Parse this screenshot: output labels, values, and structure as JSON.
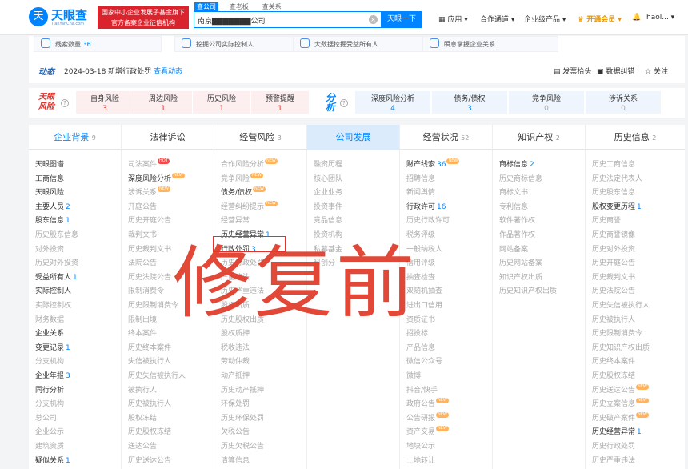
{
  "brand": {
    "logo_glyph": "天",
    "logo_text": "天眼查",
    "logo_sub": "TianYanCha.com",
    "promo_line1": "国家中小企业发展子基金旗下",
    "promo_line2": "官方备案企业征信机构"
  },
  "search": {
    "tabs": [
      "查公司",
      "查老板",
      "查关系"
    ],
    "value": "南京▇▇▇▇▇▇▇公司",
    "clear_glyph": "×",
    "button": "天眼一下"
  },
  "nav": {
    "app": "应用 ▾",
    "channel": "合作通道 ▾",
    "enterprise": "企业级产品 ▾",
    "vip": "开通会员 ▾",
    "user": "haol... ▾"
  },
  "features": [
    {
      "label": "线索数量",
      "num": "36"
    },
    {
      "label": "挖掘公司实际控制人",
      "num": ""
    },
    {
      "label": "大数据挖掘受益所有人",
      "num": ""
    },
    {
      "label": "瞬息掌握企业关系",
      "num": ""
    }
  ],
  "dynamics": {
    "label": "动态",
    "text": "2024-03-18 新增行政处罚",
    "link": "查看动态"
  },
  "actions": {
    "invoice": "发票抬头",
    "correct": "数据纠错",
    "follow": "关注"
  },
  "risk": {
    "logo": "天眼风险",
    "cells": [
      {
        "label": "自身风险",
        "n": "3"
      },
      {
        "label": "周边风险",
        "n": "1"
      },
      {
        "label": "历史风险",
        "n": "1"
      },
      {
        "label": "预警提醒",
        "n": "1"
      }
    ],
    "fx_logo": "分析",
    "fx_cells": [
      {
        "label": "深度风险分析",
        "n": "4"
      },
      {
        "label": "债务/债权",
        "n": "3"
      },
      {
        "label": "竞争风险",
        "n": "0"
      },
      {
        "label": "涉诉关系",
        "n": "0"
      }
    ]
  },
  "tabs": [
    {
      "label": "企业背景",
      "count": "9"
    },
    {
      "label": "法律诉讼",
      "count": ""
    },
    {
      "label": "经营风险",
      "count": "3"
    },
    {
      "label": "公司发展",
      "count": ""
    },
    {
      "label": "经营状况",
      "count": "52"
    },
    {
      "label": "知识产权",
      "count": "2"
    },
    {
      "label": "历史信息",
      "count": "2"
    }
  ],
  "columns": [
    [
      {
        "t": "天眼图谱"
      },
      {
        "t": "工商信息"
      },
      {
        "t": "天眼风险"
      },
      {
        "t": "主要人员",
        "n": "2"
      },
      {
        "t": "股东信息",
        "n": "1"
      },
      {
        "t": "历史股东信息",
        "dim": true
      },
      {
        "t": "对外投资",
        "dim": true
      },
      {
        "t": "历史对外投资",
        "dim": true
      },
      {
        "t": "受益所有人",
        "n": "1"
      },
      {
        "t": "实际控制人"
      },
      {
        "t": "实际控制权",
        "dim": true
      },
      {
        "t": "财务数据",
        "dim": true
      },
      {
        "t": "企业关系"
      },
      {
        "t": "变更记录",
        "n": "1"
      },
      {
        "t": "分支机构",
        "dim": true
      },
      {
        "t": "企业年报",
        "n": "3"
      },
      {
        "t": "同行分析"
      },
      {
        "t": "分支机构",
        "dim": true
      },
      {
        "t": "总公司",
        "dim": true
      },
      {
        "t": "企业公示",
        "dim": true
      },
      {
        "t": "建筑资质",
        "dim": true
      },
      {
        "t": "疑似关系",
        "n": "1"
      }
    ],
    [
      {
        "t": "司法案件",
        "dim": true,
        "b": "HOT",
        "hot": true
      },
      {
        "t": "深度风险分析",
        "b": "NEW"
      },
      {
        "t": "涉诉关系",
        "dim": true,
        "b": "NEW"
      },
      {
        "t": "开庭公告",
        "dim": true
      },
      {
        "t": "历史开庭公告",
        "dim": true
      },
      {
        "t": "裁判文书",
        "dim": true
      },
      {
        "t": "历史裁判文书",
        "dim": true
      },
      {
        "t": "法院公告",
        "dim": true
      },
      {
        "t": "历史法院公告",
        "dim": true
      },
      {
        "t": "限制消费令",
        "dim": true
      },
      {
        "t": "历史限制消费令",
        "dim": true
      },
      {
        "t": "限制出境",
        "dim": true
      },
      {
        "t": "终本案件",
        "dim": true
      },
      {
        "t": "历史终本案件",
        "dim": true
      },
      {
        "t": "失信被执行人",
        "dim": true
      },
      {
        "t": "历史失信被执行人",
        "dim": true
      },
      {
        "t": "被执行人",
        "dim": true
      },
      {
        "t": "历史被执行人",
        "dim": true
      },
      {
        "t": "股权冻结",
        "dim": true
      },
      {
        "t": "历史股权冻结",
        "dim": true
      },
      {
        "t": "送达公告",
        "dim": true
      },
      {
        "t": "历史送达公告",
        "dim": true
      }
    ],
    [
      {
        "t": "合作风险分析",
        "dim": true,
        "b": "NEW"
      },
      {
        "t": "竞争风险",
        "dim": true,
        "b": "NEW"
      },
      {
        "t": "债务/债权",
        "b": "NEW"
      },
      {
        "t": "经营纠纷提示",
        "dim": true,
        "b": "NEW"
      },
      {
        "t": "经营异常",
        "dim": true
      },
      {
        "t": "历史经营异常",
        "n": "1"
      },
      {
        "t": "行政处罚",
        "n": "3"
      },
      {
        "t": "历史行政处罚",
        "dim": true
      },
      {
        "t": "严重违法",
        "dim": true
      },
      {
        "t": "历史严重违法",
        "dim": true
      },
      {
        "t": "股权出质",
        "dim": true
      },
      {
        "t": "历史股权出质",
        "dim": true
      },
      {
        "t": "股权质押",
        "dim": true
      },
      {
        "t": "税收违法",
        "dim": true
      },
      {
        "t": "劳动仲裁",
        "dim": true
      },
      {
        "t": "动产抵押",
        "dim": true
      },
      {
        "t": "历史动产抵押",
        "dim": true
      },
      {
        "t": "环保处罚",
        "dim": true
      },
      {
        "t": "历史环保处罚",
        "dim": true
      },
      {
        "t": "欠税公告",
        "dim": true
      },
      {
        "t": "历史欠税公告",
        "dim": true
      },
      {
        "t": "清算信息",
        "dim": true
      }
    ],
    [
      {
        "t": "融资历程",
        "dim": true
      },
      {
        "t": "核心团队",
        "dim": true
      },
      {
        "t": "企业业务",
        "dim": true
      },
      {
        "t": "投资事件",
        "dim": true
      },
      {
        "t": "竞品信息",
        "dim": true
      },
      {
        "t": "投资机构",
        "dim": true
      },
      {
        "t": "私募基金",
        "dim": true
      },
      {
        "t": "科创分",
        "dim": true
      }
    ],
    [
      {
        "t": "财产线索",
        "n": "36",
        "b": "NEW"
      },
      {
        "t": "招聘信息",
        "dim": true
      },
      {
        "t": "新闻舆情",
        "dim": true
      },
      {
        "t": "行政许可",
        "n": "16"
      },
      {
        "t": "历史行政许可",
        "dim": true
      },
      {
        "t": "税务评级",
        "dim": true
      },
      {
        "t": "一般纳税人",
        "dim": true
      },
      {
        "t": "信用评级",
        "dim": true
      },
      {
        "t": "抽查检查",
        "dim": true
      },
      {
        "t": "双随机抽查",
        "dim": true
      },
      {
        "t": "进出口信用",
        "dim": true
      },
      {
        "t": "资质证书",
        "dim": true
      },
      {
        "t": "招投标",
        "dim": true
      },
      {
        "t": "产品信息",
        "dim": true
      },
      {
        "t": "微信公众号",
        "dim": true
      },
      {
        "t": "微博",
        "dim": true
      },
      {
        "t": "抖音/快手",
        "dim": true
      },
      {
        "t": "政府公告",
        "dim": true,
        "b": "NEW"
      },
      {
        "t": "公告研报",
        "dim": true,
        "b": "NEW"
      },
      {
        "t": "资产交易",
        "dim": true,
        "b": "NEW"
      },
      {
        "t": "地块公示",
        "dim": true
      },
      {
        "t": "土地转让",
        "dim": true
      }
    ],
    [
      {
        "t": "商标信息",
        "n": "2"
      },
      {
        "t": "历史商标信息",
        "dim": true
      },
      {
        "t": "商标文书",
        "dim": true
      },
      {
        "t": "专利信息",
        "dim": true
      },
      {
        "t": "软件著作权",
        "dim": true
      },
      {
        "t": "作品著作权",
        "dim": true
      },
      {
        "t": "网站备案",
        "dim": true
      },
      {
        "t": "历史网站备案",
        "dim": true
      },
      {
        "t": "知识产权出质",
        "dim": true
      },
      {
        "t": "历史知识产权出质",
        "dim": true
      }
    ],
    [
      {
        "t": "历史工商信息",
        "dim": true
      },
      {
        "t": "历史法定代表人",
        "dim": true
      },
      {
        "t": "历史股东信息",
        "dim": true
      },
      {
        "t": "股权变更历程",
        "n": "1"
      },
      {
        "t": "历史商誉",
        "dim": true
      },
      {
        "t": "历史商誉镜像",
        "dim": true
      },
      {
        "t": "历史对外投资",
        "dim": true
      },
      {
        "t": "历史开庭公告",
        "dim": true
      },
      {
        "t": "历史裁判文书",
        "dim": true
      },
      {
        "t": "历史法院公告",
        "dim": true
      },
      {
        "t": "历史失信被执行人",
        "dim": true
      },
      {
        "t": "历史被执行人",
        "dim": true
      },
      {
        "t": "历史限制消费令",
        "dim": true
      },
      {
        "t": "历史知识产权出质",
        "dim": true
      },
      {
        "t": "历史终本案件",
        "dim": true
      },
      {
        "t": "历史股权冻结",
        "dim": true
      },
      {
        "t": "历史送达公告",
        "dim": true,
        "b": "NEW"
      },
      {
        "t": "历史立案信息",
        "dim": true,
        "b": "NEW"
      },
      {
        "t": "历史破产案件",
        "dim": true,
        "b": "NEW"
      },
      {
        "t": "历史经营异常",
        "n": "1"
      },
      {
        "t": "历史行政处罚",
        "dim": true
      },
      {
        "t": "历史严重违法",
        "dim": true
      }
    ]
  ],
  "watermark": "修复前",
  "colors": {
    "brand": "#0084ff",
    "risk_red": "#e0322c",
    "watermark": "#e03b2a",
    "vip": "#e69500"
  }
}
